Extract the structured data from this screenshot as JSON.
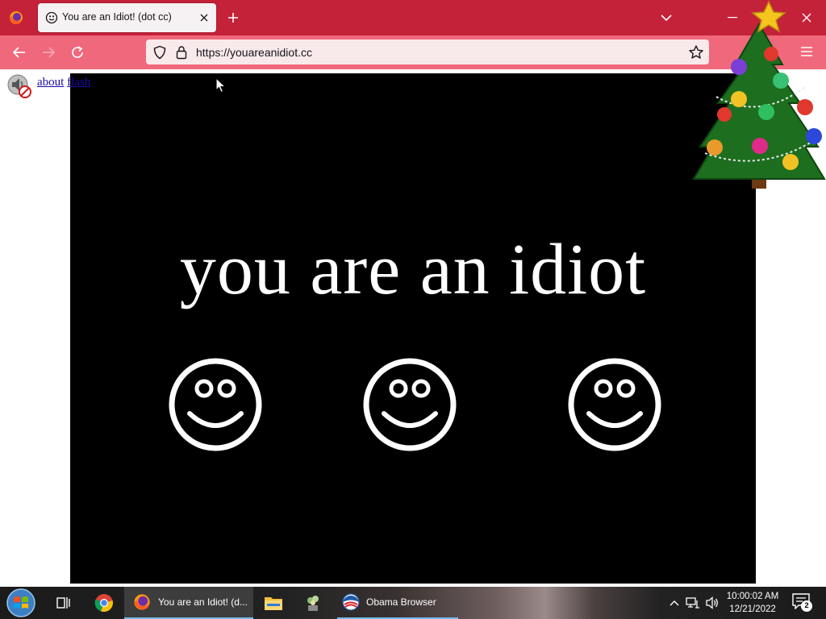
{
  "browser": {
    "tab": {
      "title": "You are an Idiot! (dot cc)"
    },
    "url": "https://youareanidiot.cc"
  },
  "page": {
    "links": {
      "about": "about",
      "flash": "flash"
    },
    "headline": "you are an idiot",
    "smiley_count": 3
  },
  "taskbar": {
    "items": [
      {
        "label": "You are an Idiot! (d..."
      },
      {
        "label": "Obama Browser"
      }
    ],
    "clock": {
      "time": "10:00:02 AM",
      "date": "12/21/2022"
    },
    "notification_count": "2"
  },
  "colors": {
    "tabbar": "#c42239",
    "navbar": "#f0687b",
    "stage": "#000000",
    "link": "#1a0dab"
  }
}
